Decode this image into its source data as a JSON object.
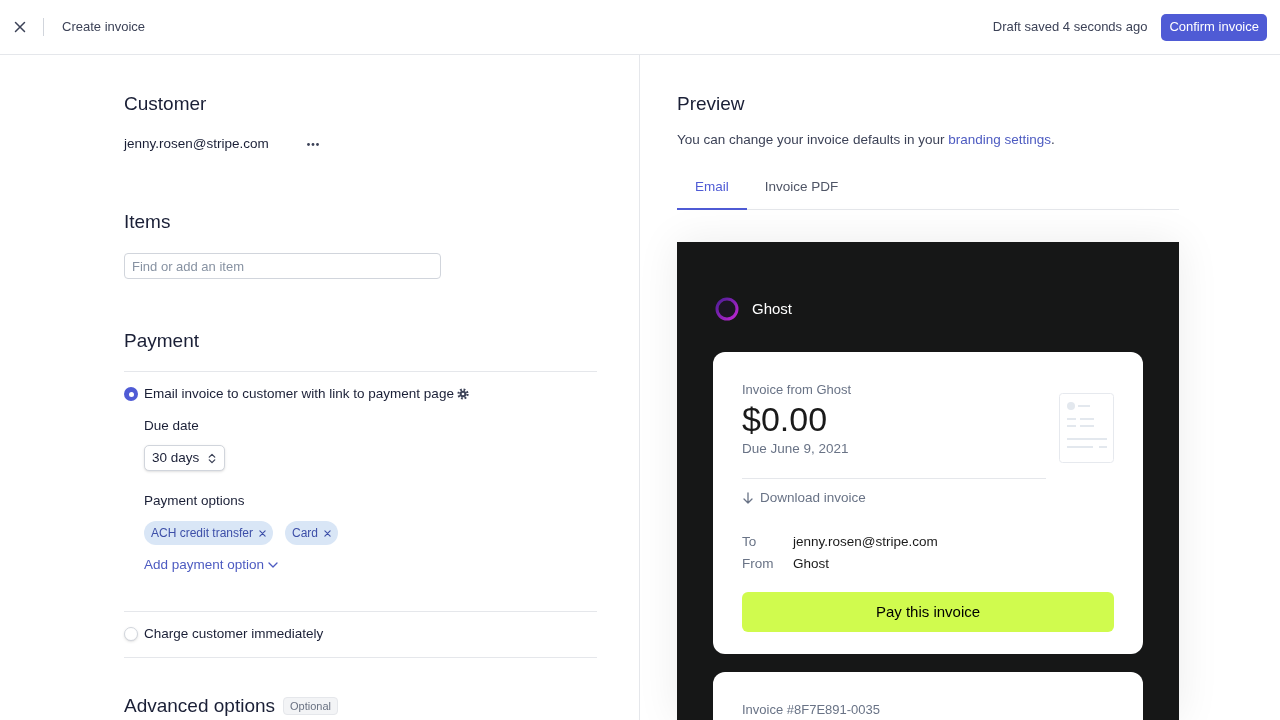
{
  "header": {
    "title": "Create invoice",
    "draft_status": "Draft saved 4 seconds ago",
    "confirm_button": "Confirm invoice"
  },
  "customer": {
    "heading": "Customer",
    "email": "jenny.rosen@stripe.com"
  },
  "items": {
    "heading": "Items",
    "search": {
      "placeholder": "Find or add an item"
    }
  },
  "payment": {
    "heading": "Payment",
    "methods": [
      {
        "label": "Email invoice to customer with link to payment page",
        "selected": true,
        "details": {
          "due_date": {
            "label": "Due date",
            "value": "30 days"
          },
          "payment_options": {
            "label": "Payment options",
            "options": [
              "ACH credit transfer",
              "Card"
            ],
            "add_link": "Add payment option"
          }
        }
      },
      {
        "label": "Charge customer immediately",
        "selected": false
      }
    ]
  },
  "advanced_options": {
    "heading": "Advanced options",
    "badge": "Optional"
  },
  "preview": {
    "heading": "Preview",
    "note": {
      "text": "You can change your invoice defaults in your",
      "link": "branding settings",
      "end": "."
    },
    "tabs": [
      {
        "label": "Email",
        "selected": true
      },
      {
        "label": "Invoice PDF",
        "selected": false
      }
    ],
    "email": {
      "brand": "Ghost",
      "invoice_card": {
        "title": "Invoice from Ghost",
        "amount": "$0.00",
        "due": "Due June 9, 2021",
        "download": "Download invoice",
        "fields": [
          {
            "label": "To",
            "value": "jenny.rosen@stripe.com"
          },
          {
            "label": "From",
            "value": "Ghost"
          }
        ],
        "pay_button": "Pay this invoice"
      },
      "next_card": {
        "invoice_number": "Invoice #8F7E891-0035"
      }
    }
  }
}
